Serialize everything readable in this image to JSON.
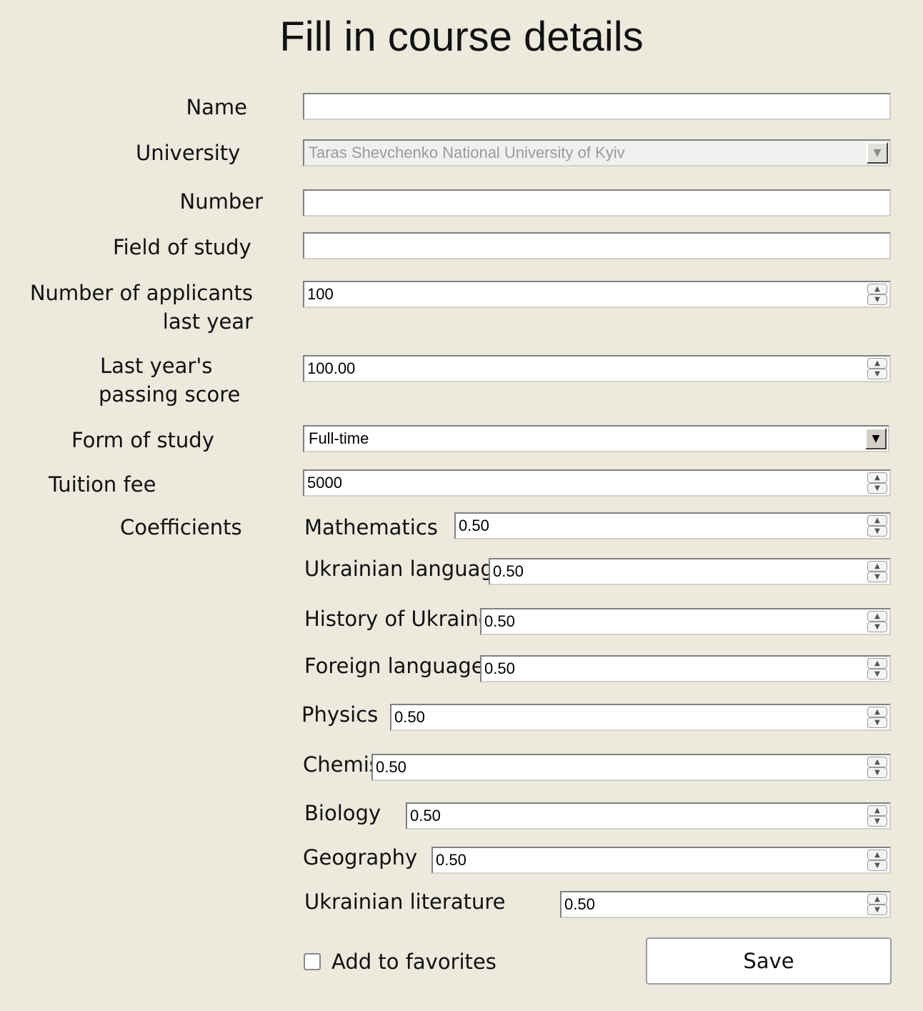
{
  "title": "Fill in course details",
  "fields": {
    "name": {
      "label": "Name",
      "value": ""
    },
    "university": {
      "label": "University",
      "value": "Taras Shevchenko National University of Kyiv"
    },
    "number": {
      "label": "Number",
      "value": ""
    },
    "field_of_study": {
      "label": "Field of study",
      "value": ""
    },
    "applicants": {
      "label_line1": "Number of applicants",
      "label_line2": "last year",
      "value": "100"
    },
    "passing_score": {
      "label_line1": "Last year's",
      "label_line2": "passing score",
      "value": "100.00"
    },
    "form_of_study": {
      "label": "Form of study",
      "value": "Full-time"
    },
    "tuition_fee": {
      "label": "Tuition fee",
      "value": "5000"
    }
  },
  "coefficients": {
    "label": "Coefficients",
    "items": [
      {
        "label": "Mathematics",
        "value": "0.50"
      },
      {
        "label": "Ukrainian language",
        "value": "0.50"
      },
      {
        "label": "History of Ukraine",
        "value": "0.50"
      },
      {
        "label": "Foreign language",
        "value": "0.50"
      },
      {
        "label": "Physics",
        "value": "0.50"
      },
      {
        "label": "Chemistry",
        "value": "0.50"
      },
      {
        "label": "Biology",
        "value": "0.50"
      },
      {
        "label": "Geography",
        "value": "0.50"
      },
      {
        "label": "Ukrainian literature",
        "value": "0.50"
      }
    ]
  },
  "favorites": {
    "label": "Add to favorites",
    "checked": false
  },
  "save_label": "Save",
  "icons": {
    "spin_up": "▲",
    "spin_down": "▼",
    "dropdown": "▼"
  }
}
